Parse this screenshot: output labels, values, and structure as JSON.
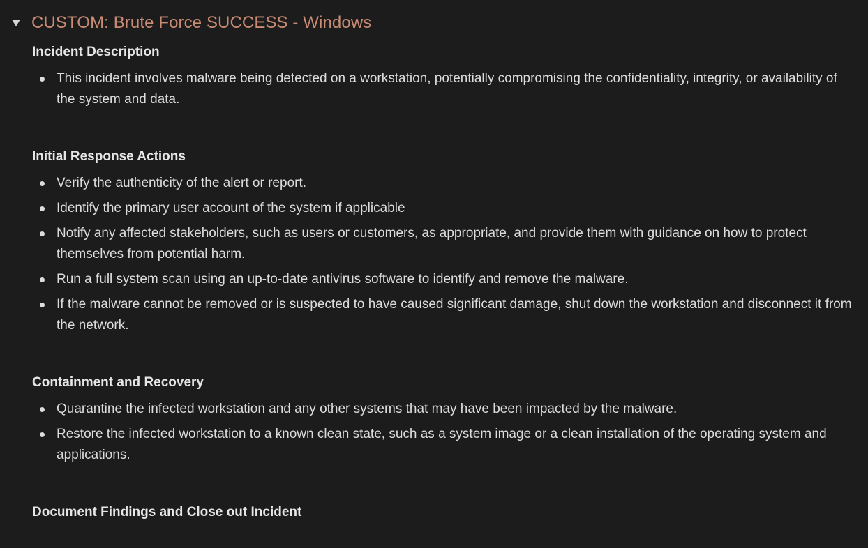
{
  "header": {
    "title": "CUSTOM: Brute Force SUCCESS - Windows"
  },
  "sections": [
    {
      "heading": "Incident Description",
      "items": [
        "This incident involves malware being detected on a workstation, potentially compromising the confidentiality, integrity, or availability of the system and data."
      ]
    },
    {
      "heading": "Initial Response Actions",
      "items": [
        "Verify the authenticity of the alert or report.",
        "Identify the primary user account of the system if applicable",
        "Notify any affected stakeholders, such as users or customers, as appropriate, and provide them with guidance on how to protect themselves from potential harm.",
        "Run a full system scan using an up-to-date antivirus software to identify and remove the malware.",
        "If the malware cannot be removed or is suspected to have caused significant damage, shut down the workstation and disconnect it from the network."
      ]
    },
    {
      "heading": "Containment and Recovery",
      "items": [
        "Quarantine the infected workstation and any other systems that may have been impacted by the malware.",
        "Restore the infected workstation to a known clean state, such as a system image or a clean installation of the operating system and applications."
      ]
    },
    {
      "heading": "Document Findings and Close out Incident",
      "items": []
    }
  ],
  "colors": {
    "background": "#1c1c1d",
    "title": "#c98b73",
    "text": "#dcdcdc"
  },
  "icons": {
    "toggle": "triangle-down-icon",
    "bullet": "bullet-dot-icon"
  }
}
